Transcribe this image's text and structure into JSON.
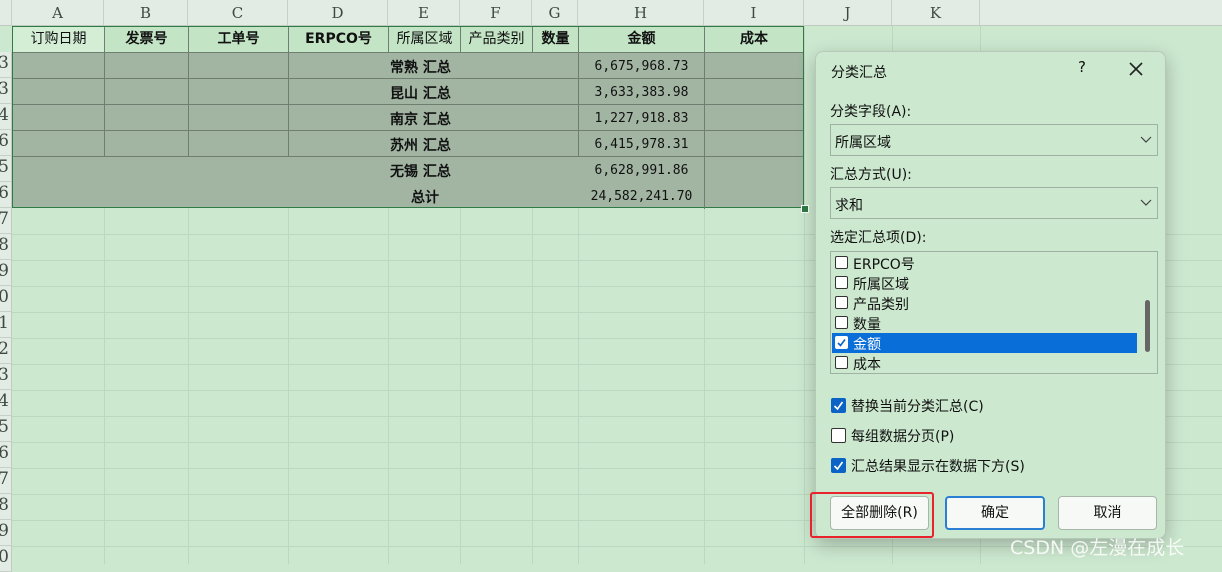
{
  "columns": [
    "A",
    "B",
    "C",
    "D",
    "E",
    "F",
    "G",
    "H",
    "I",
    "J",
    "K"
  ],
  "rows": [
    "3",
    "3",
    "4",
    "6",
    "5",
    "6",
    "7",
    "8",
    "9",
    "0",
    "1",
    "2",
    "3",
    "4",
    "5",
    "6",
    "7",
    "8",
    "9",
    "0"
  ],
  "table": {
    "headers": [
      "订购日期",
      "发票号",
      "工单号",
      "ERPCO号",
      "所属区域",
      "产品类别",
      "数量",
      "金额",
      "成本"
    ],
    "subtotal_rows": [
      {
        "label": "常熟 汇总",
        "amount": "6,675,968.73"
      },
      {
        "label": "昆山 汇总",
        "amount": "3,633,383.98"
      },
      {
        "label": "南京 汇总",
        "amount": "1,227,918.83"
      },
      {
        "label": "苏州 汇总",
        "amount": "6,415,978.31"
      },
      {
        "label": "无锡 汇总",
        "amount": "6,628,991.86"
      }
    ],
    "total_row": {
      "label": "总计",
      "amount": "24,582,241.70"
    }
  },
  "dialog": {
    "title": "分类汇总",
    "help": "?",
    "group_field_label": "分类字段(A):",
    "group_field_value": "所属区域",
    "function_label": "汇总方式(U):",
    "function_value": "求和",
    "items_label": "选定汇总项(D):",
    "items": [
      {
        "label": "ERPCO号",
        "checked": false,
        "selected": false
      },
      {
        "label": "所属区域",
        "checked": false,
        "selected": false
      },
      {
        "label": "产品类别",
        "checked": false,
        "selected": false
      },
      {
        "label": "数量",
        "checked": false,
        "selected": false
      },
      {
        "label": "金额",
        "checked": true,
        "selected": true
      },
      {
        "label": "成本",
        "checked": false,
        "selected": false
      }
    ],
    "options": [
      {
        "label": "替换当前分类汇总(C)",
        "checked": true
      },
      {
        "label": "每组数据分页(P)",
        "checked": false
      },
      {
        "label": "汇总结果显示在数据下方(S)",
        "checked": true
      }
    ],
    "remove_all_label": "全部删除(R)",
    "ok_label": "确定",
    "cancel_label": "取消"
  },
  "watermark": "CSDN @左漫在成长",
  "colors": {
    "background": "#cce8cf",
    "table": "#a2b5a3",
    "accent": "#0a6ed8",
    "highlight": "#e8232b"
  }
}
